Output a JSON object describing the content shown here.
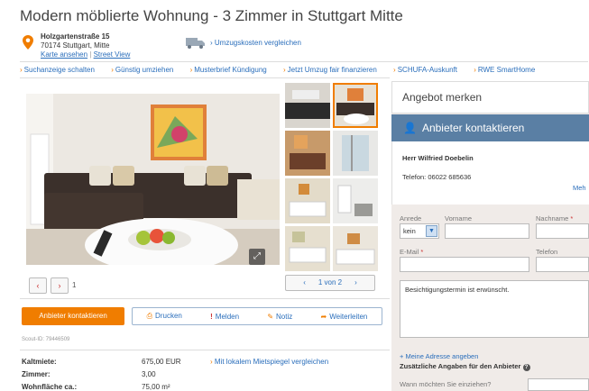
{
  "title": "Modern möblierte Wohnung - 3 Zimmer in Stuttgart Mitte",
  "address": {
    "street": "Holzgartenstraße 15",
    "city": "70174 Stuttgart, Mitte",
    "map_link": "Karte ansehen",
    "street_view": "Street View"
  },
  "move_link": "Umzugskosten vergleichen",
  "links": [
    "Suchanzeige schalten",
    "Günstig umziehen",
    "Musterbrief Kündigung",
    "Jetzt Umzug fair finanzieren",
    "SCHUFA-Auskunft",
    "RWE SmartHome"
  ],
  "gallery": {
    "current_index": "1",
    "pager": "1 von 2",
    "prev": "‹",
    "next": "›"
  },
  "actions": {
    "contact_button": "Anbieter kontaktieren",
    "print": "Drucken",
    "report": "Melden",
    "note": "Notiz",
    "forward": "Weiterleiten"
  },
  "scout_id": "Scout-ID: 79446509",
  "details": {
    "rent_label": "Kaltmiete:",
    "rent_value": "675,00 EUR",
    "rent_link": "Mit lokalem Mietspiegel vergleichen",
    "rooms_label": "Zimmer:",
    "rooms_value": "3,00",
    "area_label": "Wohnfläche ca.:",
    "area_value": "75,00 m²"
  },
  "panel": {
    "merken": "Angebot merken",
    "contact_header": "Anbieter kontaktieren",
    "person_name": "Herr Wilfried Doebelin",
    "phone": "Telefon: 06022 685636",
    "more": "Meh",
    "anrede_label": "Anrede",
    "anrede_value": "kein",
    "vorname_label": "Vorname",
    "nachname_label": "Nachname",
    "email_label": "E-Mail",
    "telefon_label": "Telefon",
    "message": "Besichtigungstermin ist erwünscht.",
    "my_address_link": "Meine Adresse angeben",
    "extra_header": "Zusätzliche Angaben für den Anbieter",
    "when_placeholder": "Wann möchten Sie einziehen?"
  },
  "colors": {
    "accent": "#f07d00",
    "link": "#2a6ebb",
    "panel_header": "#5a7fa4"
  }
}
